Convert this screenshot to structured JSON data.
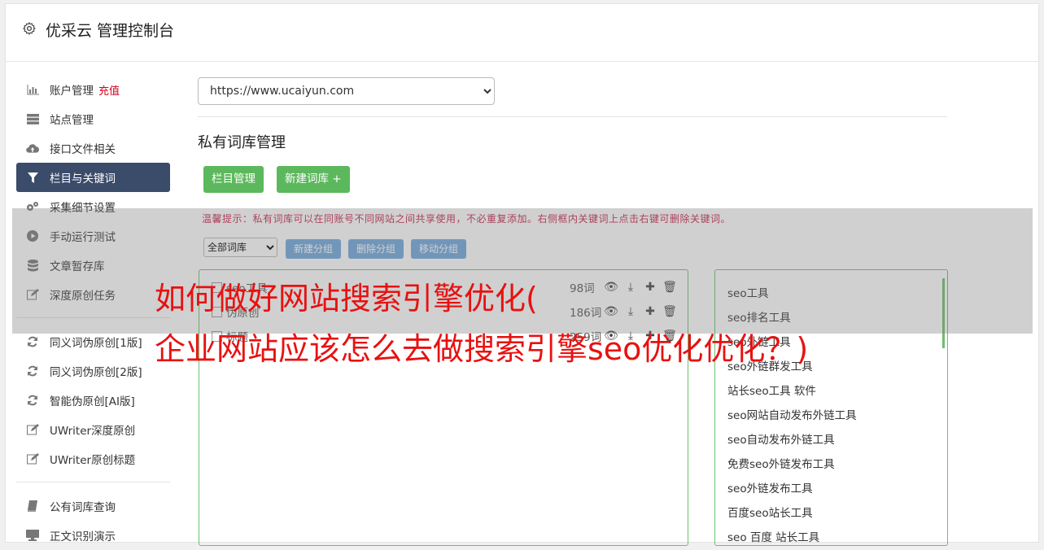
{
  "header": {
    "title": "优采云 管理控制台",
    "icon": "gear-icon"
  },
  "sidebar": {
    "group1": [
      {
        "label": "账户管理",
        "badge": "充值",
        "icon": "bar-chart-icon"
      },
      {
        "label": "站点管理",
        "icon": "server-icon"
      },
      {
        "label": "接口文件相关",
        "icon": "cloud-upload-icon"
      },
      {
        "label": "栏目与关键词",
        "icon": "filter-icon",
        "active": true
      },
      {
        "label": "采集细节设置",
        "icon": "cogs-icon"
      },
      {
        "label": "手动运行测试",
        "icon": "play-circle-icon"
      },
      {
        "label": "文章暂存库",
        "icon": "database-icon"
      },
      {
        "label": "深度原创任务",
        "icon": "edit-icon"
      }
    ],
    "group2": [
      {
        "label": "同义词伪原创[1版]",
        "icon": "refresh-icon"
      },
      {
        "label": "同义词伪原创[2版]",
        "icon": "refresh-icon"
      },
      {
        "label": "智能伪原创[AI版]",
        "icon": "refresh-icon"
      },
      {
        "label": "UWriter深度原创",
        "icon": "edit-icon"
      },
      {
        "label": "UWriter原创标题",
        "icon": "edit-icon"
      }
    ],
    "group3": [
      {
        "label": "公有词库查询",
        "icon": "book-icon"
      },
      {
        "label": "正文识别演示",
        "icon": "monitor-icon"
      }
    ]
  },
  "main": {
    "site_select": "https://www.ucaiyun.com",
    "section_title": "私有词库管理",
    "btn_column": "栏目管理",
    "btn_new_lib": "新建词库 +",
    "tip": "温馨提示：私有词库可以在同账号不同网站之间共享使用，不必重复添加。右侧框内关键词上点击右键可删除关键词。",
    "lib_select": "全部词库",
    "btn_new_group": "新建分组",
    "btn_del_group": "删除分组",
    "btn_move_group": "移动分组",
    "libraries": [
      {
        "name": "seo工具",
        "count": "98词"
      },
      {
        "name": "伪原创",
        "count": "186词"
      },
      {
        "name": "标题",
        "count": "259词"
      }
    ],
    "keywords": [
      "seo工具",
      "seo排名工具",
      "seo外链工具",
      "seo外链群发工具",
      "站长seo工具 软件",
      "seo网站自动发布外链工具",
      "seo自动发布外链工具",
      "免费seo外链发布工具",
      "seo外链发布工具",
      "百度seo站长工具",
      "seo 百度 站长工具"
    ]
  },
  "overlay": {
    "line1": "如何做好网站搜索引擎优化(",
    "line2": "企业网站应该怎么去做搜索引擎seo优化优化？)"
  }
}
